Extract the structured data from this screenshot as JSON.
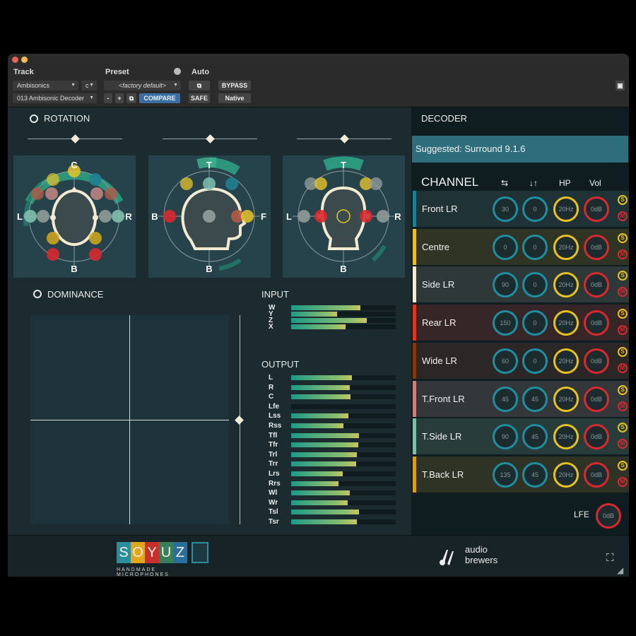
{
  "host": {
    "track_label": "Track",
    "preset_label": "Preset",
    "auto_label": "Auto",
    "track_type": "Ambisonics",
    "track_channel": "c",
    "plugin_name": "013 Ambisonic Decoder",
    "preset_value": "<factory default>",
    "minus": "-",
    "plus": "+",
    "compare": "COMPARE",
    "bypass": "BYPASS",
    "safe": "SAFE",
    "native": "Native"
  },
  "rotation": {
    "title": "ROTATION",
    "panels": [
      {
        "top": "C",
        "bottom": "B",
        "left": "L",
        "right": "R",
        "level": 0.5
      },
      {
        "top": "T",
        "bottom": "B",
        "left": "B",
        "right": "F",
        "level": 0.5
      },
      {
        "top": "T",
        "bottom": "B",
        "left": "L",
        "right": "R",
        "level": 0.5
      }
    ]
  },
  "dominance": {
    "title": "DOMINANCE"
  },
  "input": {
    "title": "INPUT",
    "channels": [
      {
        "label": "W",
        "level": 0.66
      },
      {
        "label": "Y",
        "level": 0.44
      },
      {
        "label": "Z",
        "level": 0.72
      },
      {
        "label": "X",
        "level": 0.52
      }
    ]
  },
  "output": {
    "title": "OUTPUT",
    "channels": [
      {
        "label": "L",
        "level": 0.58
      },
      {
        "label": "R",
        "level": 0.56
      },
      {
        "label": "C",
        "level": 0.57
      },
      {
        "label": "Lfe",
        "level": 0.0
      },
      {
        "label": "Lss",
        "level": 0.55
      },
      {
        "label": "Rss",
        "level": 0.5
      },
      {
        "label": "Tfl",
        "level": 0.65
      },
      {
        "label": "Tfr",
        "level": 0.64
      },
      {
        "label": "Trl",
        "level": 0.63
      },
      {
        "label": "Trr",
        "level": 0.62
      },
      {
        "label": "Lrs",
        "level": 0.49
      },
      {
        "label": "Rrs",
        "level": 0.45
      },
      {
        "label": "Wl",
        "level": 0.56
      },
      {
        "label": "Wr",
        "level": 0.54
      },
      {
        "label": "Tsl",
        "level": 0.65
      },
      {
        "label": "Tsr",
        "level": 0.63
      }
    ]
  },
  "decoder": {
    "title": "DECODER",
    "suggested": "Suggested: Surround 9.1.6",
    "channel_header": "CHANNEL",
    "col_swap": "⇆",
    "col_elev": "↓↑",
    "col_hp": "HP",
    "col_vol": "Vol",
    "solo": "S",
    "mute": "M",
    "rows": [
      {
        "name": "Front LR",
        "color": "#1a7f8e",
        "bg": "#1f3236",
        "az": "30",
        "el": "0",
        "hp": "20Hz",
        "vol": "0dB",
        "dim": false
      },
      {
        "name": "Centre",
        "color": "#e8c21e",
        "bg": "#2f3425",
        "az": "0",
        "el": "0",
        "hp": "20Hz",
        "vol": "0dB",
        "dim": true
      },
      {
        "name": "Side LR",
        "color": "#f1ead4",
        "bg": "#2e3839",
        "az": "90",
        "el": "0",
        "hp": "20Hz",
        "vol": "0dB",
        "dim": true
      },
      {
        "name": "Rear LR",
        "color": "#e0361f",
        "bg": "#372628",
        "az": "150",
        "el": "0",
        "hp": "20Hz",
        "vol": "0dB",
        "dim": false
      },
      {
        "name": "Wide LR",
        "color": "#84360f",
        "bg": "#2b2726",
        "az": "60",
        "el": "0",
        "hp": "20Hz",
        "vol": "0dB",
        "dim": false
      },
      {
        "name": "T.Front LR",
        "color": "#c98279",
        "bg": "#33373a",
        "az": "45",
        "el": "45",
        "hp": "20Hz",
        "vol": "0dB",
        "dim": true
      },
      {
        "name": "T.Side LR",
        "color": "#7fbfa9",
        "bg": "#283c3c",
        "az": "90",
        "el": "45",
        "hp": "20Hz",
        "vol": "0dB",
        "dim": false
      },
      {
        "name": "T.Back LR",
        "color": "#d4a015",
        "bg": "#2e3326",
        "az": "135",
        "el": "45",
        "hp": "20Hz",
        "vol": "0dB",
        "dim": false
      }
    ],
    "lfe_label": "LFE",
    "lfe_vol": "0dB"
  },
  "footer": {
    "soyuz_letters": [
      "S",
      "O",
      "Y",
      "U",
      "Z"
    ],
    "soyuz_tagline": "HANDMADE MICROPHONES",
    "brand_line1": "audio",
    "brand_line2": "brewers"
  },
  "colors": {
    "teal": "#1e8fa0",
    "yellow": "#e8c21e",
    "red": "#d8292f",
    "panel": "#26424b",
    "accent_green": "#2ea384"
  }
}
